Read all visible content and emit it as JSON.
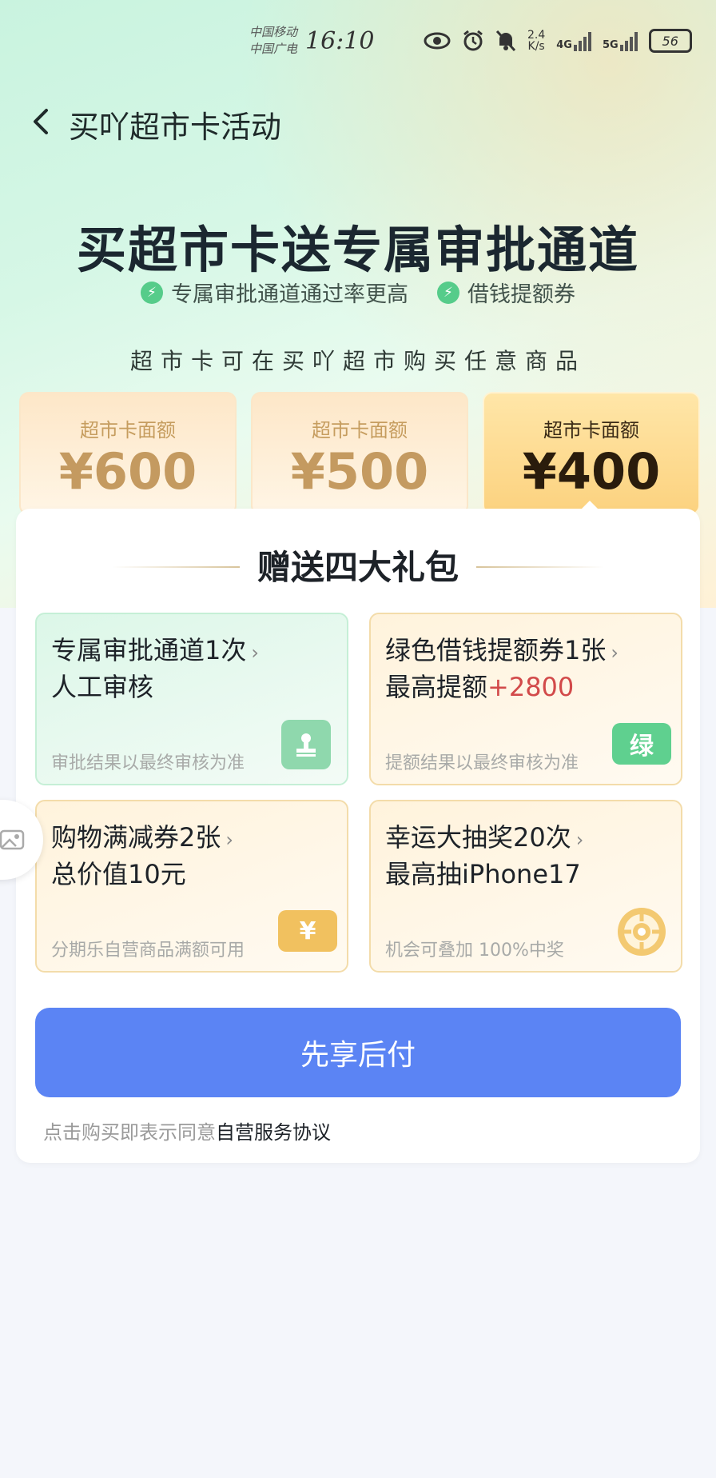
{
  "status_bar": {
    "carrier_1": "中国移动",
    "carrier_2": "中国广电",
    "time": "16:10",
    "net_speed_value": "2.4",
    "net_speed_unit": "K/s",
    "net_1": "4G",
    "net_2": "5G",
    "battery": "56"
  },
  "header": {
    "title": "买吖超市卡活动"
  },
  "hero": {
    "title": "买超市卡送专属审批通道",
    "features": [
      "专属审批通道通过率更高",
      "借钱提额券"
    ],
    "subtitle": "超市卡可在买吖超市购买任意商品"
  },
  "amounts": [
    {
      "label": "超市卡面额",
      "value": "¥600",
      "selected": false
    },
    {
      "label": "超市卡面额",
      "value": "¥500",
      "selected": false
    },
    {
      "label": "超市卡面额",
      "value": "¥400",
      "selected": true
    }
  ],
  "gifts_title": "赠送四大礼包",
  "gifts": [
    {
      "line1": "专属审批通道1次",
      "line2": "人工审核",
      "note": "审批结果以最终审核为准",
      "icon": "stamp-icon"
    },
    {
      "line1": "绿色借钱提额券1张",
      "line2_prefix": "最高提额",
      "line2_highlight": "+2800",
      "note": "提额结果以最终审核为准",
      "badge": "绿",
      "icon": "green-ticket-icon"
    },
    {
      "line1": "购物满减券2张",
      "line2": "总价值10元",
      "note": "分期乐自营商品满额可用",
      "badge": "¥",
      "icon": "yen-ticket-icon"
    },
    {
      "line1": "幸运大抽奖20次",
      "line2": "最高抽iPhone17",
      "note": "机会可叠加 100%中奖",
      "icon": "lottery-wheel-icon"
    }
  ],
  "cta_label": "先享后付",
  "agreement": {
    "prefix": "点击购买即表示同意",
    "link": "自营服务协议"
  },
  "colors": {
    "accent": "#5b84f4",
    "highlight": "#d24a4a",
    "green_badge": "#56cc8a",
    "gold_badge": "#f1c15f"
  }
}
